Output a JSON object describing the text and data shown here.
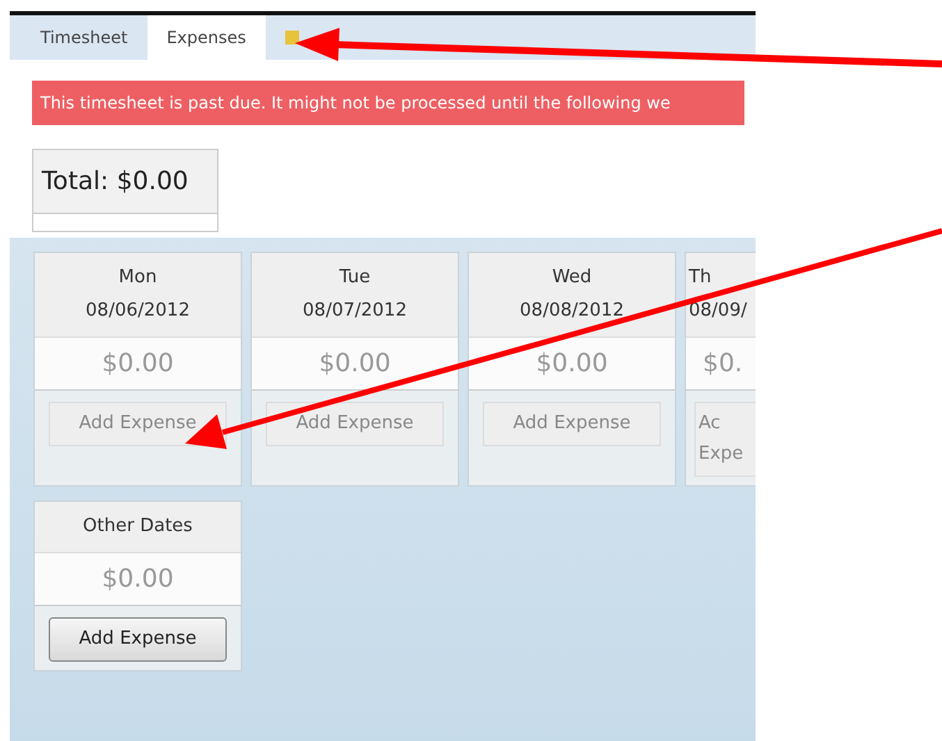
{
  "tabs": [
    {
      "label": "Timesheet",
      "selected": false,
      "icon": false
    },
    {
      "label": "Expenses",
      "selected": true,
      "icon": false
    },
    {
      "selected": false,
      "icon": true
    }
  ],
  "banner": "This timesheet is past due. It might not be processed until the following we",
  "total": "Total: $0.00",
  "days": [
    {
      "day": "Mon",
      "date": "08/06/2012",
      "amount": "$0.00",
      "button": "Add Expense",
      "disabled": true,
      "cut": false
    },
    {
      "day": "Tue",
      "date": "08/07/2012",
      "amount": "$0.00",
      "button": "Add Expense",
      "disabled": true,
      "cut": false
    },
    {
      "day": "Wed",
      "date": "08/08/2012",
      "amount": "$0.00",
      "button": "Add Expense",
      "disabled": true,
      "cut": false
    },
    {
      "day": "Th",
      "date": "08/09/",
      "amount": "$0.",
      "button": "Ac Expe",
      "disabled": true,
      "cut": true
    }
  ],
  "other": {
    "day": "Other Dates",
    "amount": "$0.00",
    "button": "Add Expense",
    "disabled": false
  }
}
